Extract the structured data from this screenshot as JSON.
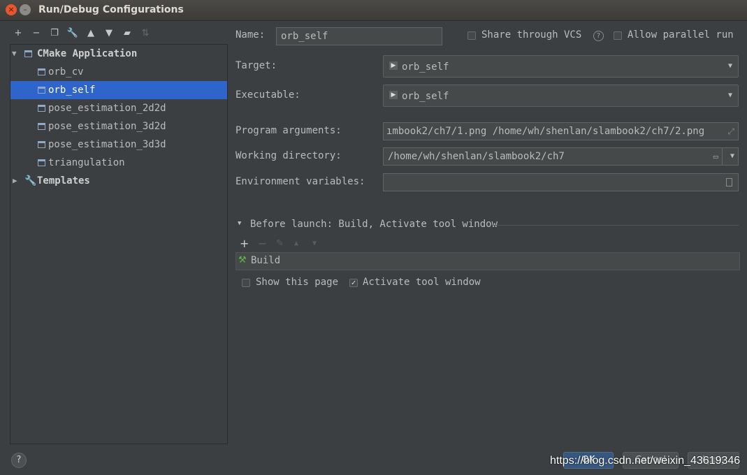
{
  "window": {
    "title": "Run/Debug Configurations",
    "close_glyph": "×",
    "minimize_glyph": "–"
  },
  "toolbar": {
    "icons": [
      "add-icon",
      "remove-icon",
      "copy-icon",
      "wrench-icon",
      "arrow-up-icon",
      "arrow-down-icon",
      "folder-add-icon",
      "sort-icon"
    ]
  },
  "tree": {
    "group_label": "CMake Application",
    "items": [
      {
        "label": "orb_cv"
      },
      {
        "label": "orb_self",
        "selected": true
      },
      {
        "label": "pose_estimation_2d2d"
      },
      {
        "label": "pose_estimation_3d2d"
      },
      {
        "label": "pose_estimation_3d3d"
      },
      {
        "label": "triangulation"
      }
    ],
    "templates_label": "Templates"
  },
  "form": {
    "name_label": "Name:",
    "name_value": "orb_self",
    "share_vcs_label": "Share through VCS",
    "allow_parallel_label": "Allow parallel run",
    "target_label": "Target:",
    "target_value": "orb_self",
    "executable_label": "Executable:",
    "executable_value": "orb_self",
    "program_args_label": "Program arguments:",
    "program_args_value": "ımbook2/ch7/1.png /home/wh/shenlan/slambook2/ch7/2.png",
    "working_dir_label": "Working directory:",
    "working_dir_value": "/home/wh/shenlan/slambook2/ch7",
    "env_vars_label": "Environment variables:",
    "env_vars_value": ""
  },
  "before_launch": {
    "header": "Before launch: Build, Activate tool window",
    "tasks": [
      {
        "label": "Build"
      }
    ],
    "show_page_label": "Show this page",
    "show_page_checked": false,
    "activate_tool_label": "Activate tool window",
    "activate_tool_checked": true
  },
  "footer": {
    "help_glyph": "?",
    "ok_label": "OK",
    "cancel_label": "Cancel",
    "apply_label": "Apply",
    "watermark": "https://blog.csdn.net/weixin_43619346"
  },
  "colors": {
    "selection": "#2f65ca",
    "background": "#3c3f41",
    "primary_button": "#365880"
  }
}
